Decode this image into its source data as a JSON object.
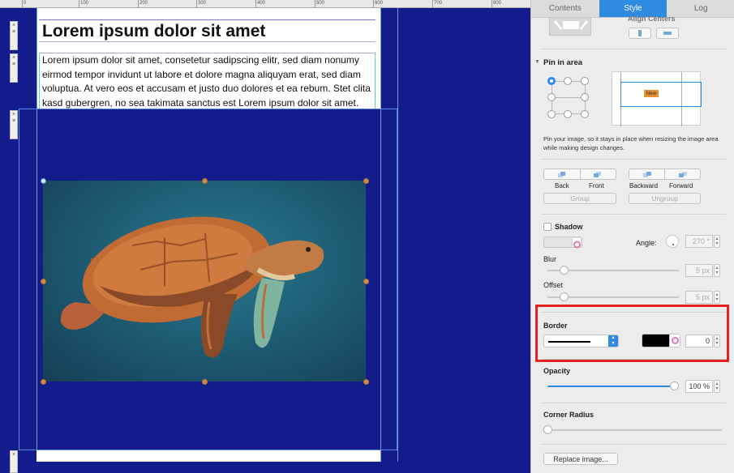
{
  "ruler": {
    "ticks": [
      "0",
      "100",
      "200",
      "300",
      "400",
      "500",
      "600",
      "700",
      "800"
    ]
  },
  "document": {
    "headline": "Lorem ipsum dolor sit amet",
    "paragraph": "Lorem ipsum dolor sit amet, consetetur sadipscing elitr, sed diam nonumy eirmod tempor invidunt ut labore et dolore magna aliquyam erat, sed diam voluptua. At vero eos et accusam et justo duo dolores et ea rebum. Stet clita kasd gubergren, no sea takimata sanctus est Lorem ipsum dolor sit amet."
  },
  "inspector": {
    "tabs": [
      {
        "label": "Contents",
        "active": false
      },
      {
        "label": "Style",
        "active": true
      },
      {
        "label": "Log",
        "active": false
      }
    ],
    "align_centers_label": "Align Centers",
    "pin": {
      "title": "Pin in area",
      "new_label": "New",
      "description": "Pin your image, so it stays in place when resizing the image area while making design changes."
    },
    "arrange": {
      "back": "Back",
      "front": "Front",
      "backward": "Backward",
      "forward": "Forward",
      "group": "Group",
      "ungroup": "Ungroup"
    },
    "shadow": {
      "label": "Shadow",
      "checked": false,
      "angle_label": "Angle:",
      "angle_value": "270 °",
      "blur_label": "Blur",
      "blur_value": "5 px",
      "offset_label": "Offset",
      "offset_value": "5 px"
    },
    "border": {
      "label": "Border",
      "color": "#000000",
      "width_value": "0"
    },
    "opacity": {
      "label": "Opacity",
      "value": "100 %",
      "level": 1.0
    },
    "corner_radius": {
      "label": "Corner Radius",
      "level": 0.0
    },
    "replace_image_label": "Replace image..."
  },
  "colors": {
    "canvas_bg": "#141c8c",
    "accent": "#2f8be0",
    "highlight": "#e42121"
  }
}
